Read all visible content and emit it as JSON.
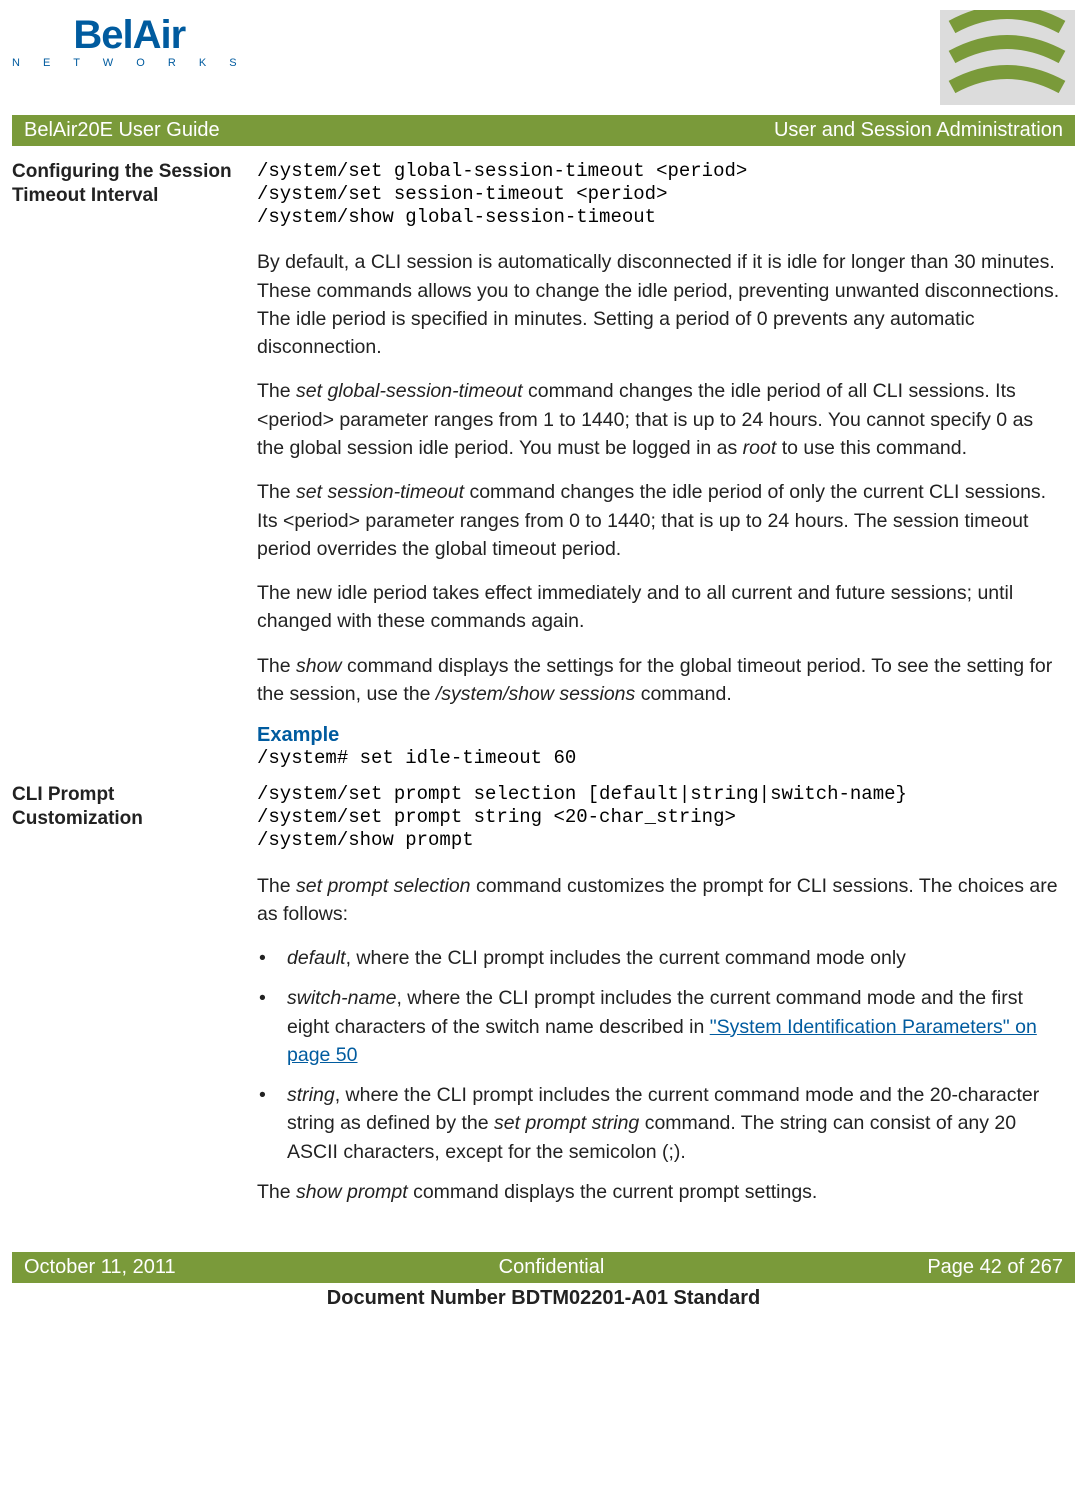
{
  "logo": {
    "main": "BelAir",
    "sub": "N E T W O R K S"
  },
  "titleBar": {
    "left": "BelAir20E User Guide",
    "right": "User and Session Administration"
  },
  "section1": {
    "heading": "Configuring the Session Timeout Interval",
    "commands": "/system/set global-session-timeout <period>\n/system/set session-timeout <period>\n/system/show global-session-timeout",
    "p1": "By default, a CLI session is automatically disconnected if it is idle for longer than 30 minutes. These commands allows you to change the idle period, preventing unwanted disconnections. The idle period is specified in minutes. Setting a period of 0 prevents any automatic disconnection.",
    "p2_a": "The ",
    "p2_i1": "set global-session-timeout",
    "p2_b": " command changes the idle period of all CLI sessions. Its <period> parameter ranges from 1 to 1440; that is up to 24 hours. You cannot specify 0 as the global session idle period. You must be logged in as ",
    "p2_i2": "root",
    "p2_c": " to use this command.",
    "p3_a": "The ",
    "p3_i1": "set session-timeout",
    "p3_b": " command changes the idle period of only the current CLI sessions. Its <period> parameter ranges from 0 to 1440; that is up to 24 hours. The session timeout period overrides the global timeout period.",
    "p4": "The new idle period takes effect immediately and to all current and future sessions; until changed with these commands again.",
    "p5_a": "The ",
    "p5_i1": "show",
    "p5_b": " command displays the settings for the global timeout period. To see the setting for the session, use the ",
    "p5_i2": "/system/show sessions",
    "p5_c": " command.",
    "exampleLabel": "Example",
    "exampleCmd": "/system# set idle-timeout 60"
  },
  "section2": {
    "heading": "CLI Prompt Customization",
    "commands": "/system/set prompt selection [default|string|switch-name}\n/system/set prompt string <20-char_string>\n/system/show prompt",
    "p1_a": "The ",
    "p1_i1": "set prompt selection",
    "p1_b": " command customizes the prompt for CLI sessions. The choices are as follows:",
    "b1_i": "default",
    "b1_t": ", where the CLI prompt includes the current command mode only",
    "b2_i": "switch-name",
    "b2_t1": ", where the CLI prompt includes the current command mode and the first eight characters of the switch name described in ",
    "b2_link": "\"System Identification Parameters\" on page 50",
    "b3_i": "string",
    "b3_t1": ", where the CLI prompt includes the current command mode and the 20-character string as defined by the ",
    "b3_i2": "set prompt string",
    "b3_t2": " command. The string can consist of any 20 ASCII characters, except for the semicolon (;).",
    "p2_a": "The ",
    "p2_i1": "show prompt",
    "p2_b": " command displays the current prompt settings."
  },
  "footer": {
    "left": "October 11, 2011",
    "center": "Confidential",
    "right": "Page 42 of 267"
  },
  "docNumber": "Document Number BDTM02201-A01 Standard"
}
